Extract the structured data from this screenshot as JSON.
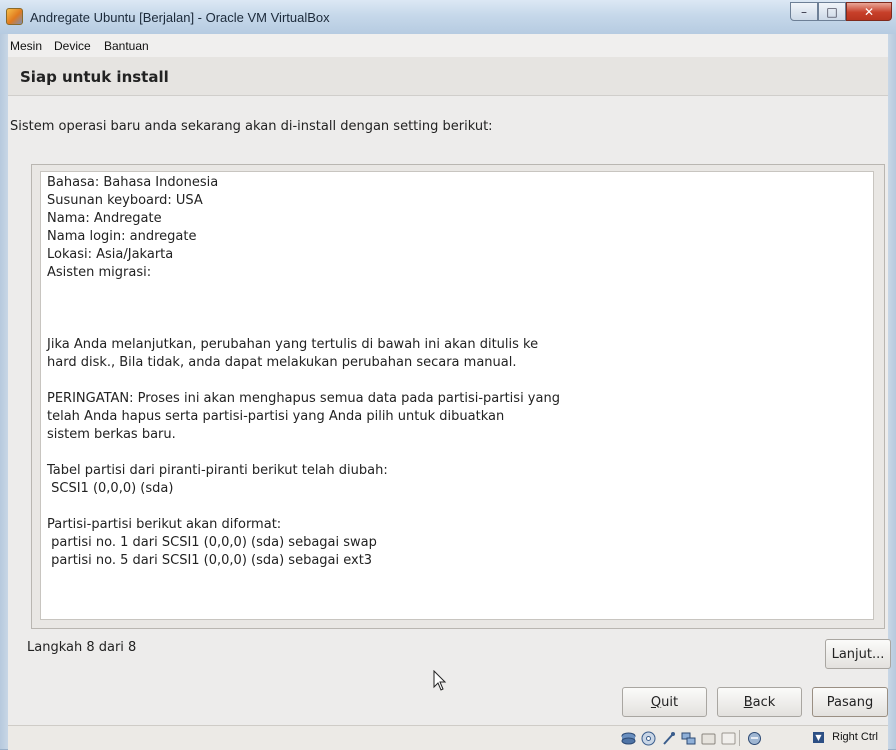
{
  "window": {
    "title": "Andregate Ubuntu [Berjalan] - Oracle VM VirtualBox",
    "min_glyph": "–",
    "max_glyph": "□",
    "close_glyph": "✕"
  },
  "menu": {
    "items": [
      "Mesin",
      "Device",
      "Bantuan"
    ]
  },
  "installer": {
    "heading": "Siap untuk install",
    "intro": "Sistem operasi baru anda sekarang akan di-install dengan setting berikut:",
    "summary_lines": [
      "Bahasa: Bahasa Indonesia",
      "Susunan keyboard: USA",
      "Nama: Andregate",
      "Nama login: andregate",
      "Lokasi: Asia/Jakarta",
      "Asisten migrasi:",
      "",
      "",
      "",
      "Jika Anda melanjutkan, perubahan yang tertulis di bawah ini akan ditulis ke",
      "hard disk., Bila tidak, anda dapat melakukan perubahan secara manual.",
      "",
      "PERINGATAN: Proses ini akan menghapus semua data pada partisi-partisi yang",
      "telah Anda hapus serta partisi-partisi yang Anda pilih untuk dibuatkan",
      "sistem berkas baru.",
      "",
      "Tabel partisi dari piranti-piranti berikut telah diubah:",
      " SCSI1 (0,0,0) (sda)",
      "",
      "Partisi-partisi berikut akan diformat:",
      " partisi no. 1 dari SCSI1 (0,0,0) (sda) sebagai swap",
      " partisi no. 5 dari SCSI1 (0,0,0) (sda) sebagai ext3"
    ],
    "advanced_button": "Lanjut...",
    "step_label": "Langkah 8 dari 8",
    "quit_first": "Q",
    "quit_rest": "uit",
    "back_first": "B",
    "back_rest": "ack",
    "install_button": "Pasang"
  },
  "statusbar": {
    "icons": [
      "hard-disk-icon",
      "cd-icon",
      "usb-icon",
      "network-icon",
      "shared-folder-icon",
      "seamless-icon",
      "recording-icon",
      "mouse-integration-icon",
      "host-key-icon"
    ],
    "host_key_label": "Right Ctrl"
  }
}
